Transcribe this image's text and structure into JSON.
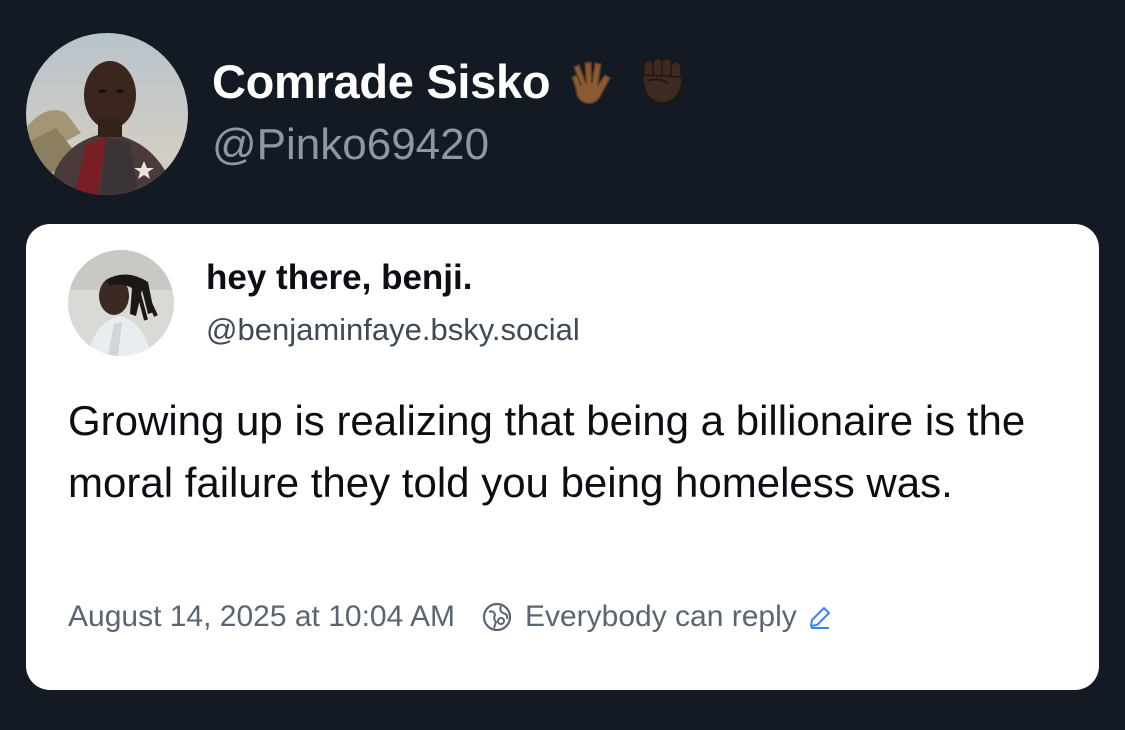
{
  "post": {
    "author": {
      "display_name": "Comrade Sisko",
      "handle": "@Pinko69420",
      "name_emojis": [
        "vulcan-salute-icon",
        "raised-fist-icon"
      ]
    }
  },
  "quoted_post": {
    "author": {
      "display_name": "hey there, benji.",
      "handle": "@benjaminfaye.bsky.social"
    },
    "text": "Growing up is realizing that being a billionaire is the moral failure they told you being homeless was.",
    "timestamp": "August 14, 2025 at 10:04 AM",
    "reply_setting": "Everybody can reply"
  },
  "colors": {
    "background": "#141a24",
    "card_background": "#ffffff",
    "handle_gray": "#8b98a5",
    "meta_gray": "#5a6573"
  }
}
